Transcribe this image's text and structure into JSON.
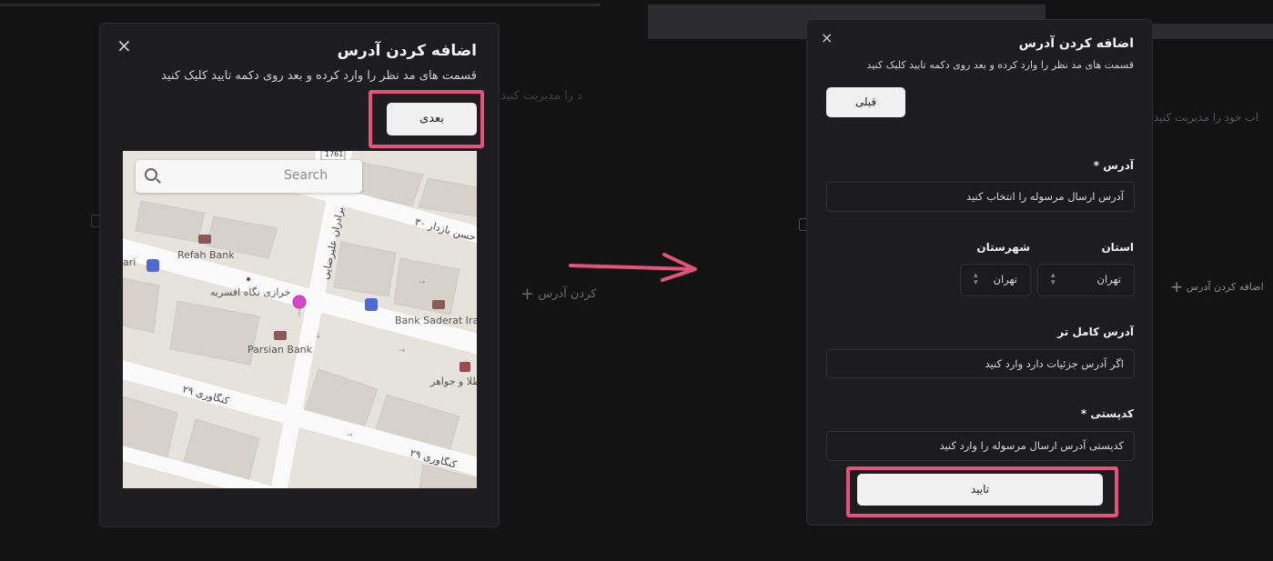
{
  "background": {
    "left_ghost_text": "د را مدیریت کنید",
    "left_ghost_add": "کردن آدرس",
    "right_ghost_text": "اب خود را مدیریت کنید",
    "right_ghost_add": "اضافه کردن آدرس"
  },
  "left_modal": {
    "title": "اضافه کردن آدرس",
    "subtitle": "قسمت های مد نظر را وارد کرده و بعد روی دکمه تایید کلیک کنید",
    "close_icon": "×",
    "next_button": "بعدی",
    "map": {
      "search_placeholder": "Search",
      "labels": {
        "refah_bank": "Refah Bank",
        "parsian_bank": "Parsian Bank",
        "bank_saderat": "Bank Saderat Ira",
        "ari": "ari",
        "khorazi": "خرازی نگاه افسریه",
        "tala": "طلا و جواهر",
        "hasan_bazdar": "حسن بازدار ۳۰",
        "baradaran": "برادران علیرضایی",
        "kangavari_1": "کنگاوری ۲۹",
        "kangavari_2": "کنگاوری ۲۹",
        "road_number": "1761"
      }
    }
  },
  "right_modal": {
    "title": "اضافه کردن آدرس",
    "subtitle": "قسمت های مد نظر را وارد کرده و بعد روی دکمه تایید کلیک کنید",
    "close_icon": "×",
    "prev_button": "قبلی",
    "address_label": "آدرس *",
    "address_placeholder": "آدرس ارسال مرسوله را انتخاب کنید",
    "province_label": "استان",
    "province_value": "تهران",
    "city_label": "شهرستان",
    "city_value": "تهران",
    "full_address_label": "آدرس کامل تر",
    "full_address_placeholder": "اگر آدرس جزئیات دارد وارد کنید",
    "postal_label": "کدپستی *",
    "postal_placeholder": "کدپستی آدرس ارسال مرسوله را وارد کنید",
    "confirm_button": "تایید"
  },
  "colors": {
    "highlight": "#e2547d",
    "arrow": "#e2547d",
    "pin": "#d447c6"
  }
}
